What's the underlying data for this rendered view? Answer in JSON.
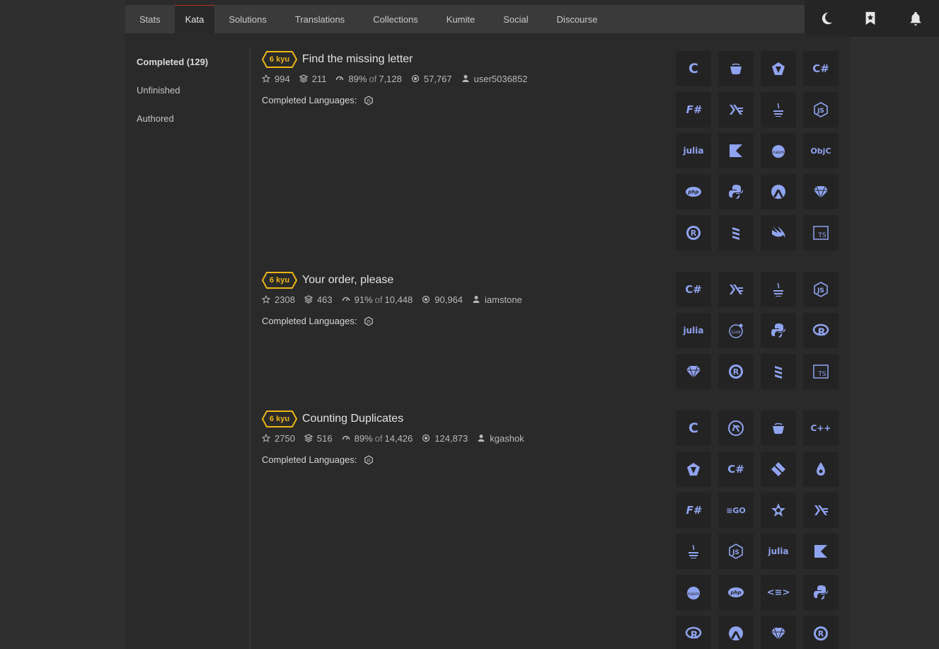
{
  "nav": {
    "tabs": [
      "Stats",
      "Kata",
      "Solutions",
      "Translations",
      "Collections",
      "Kumite",
      "Social",
      "Discourse"
    ],
    "active_tab": "Kata",
    "icons": [
      "moon-icon",
      "bookmark-star-icon",
      "bell-icon"
    ]
  },
  "sidebar": {
    "items": [
      {
        "label": "Completed (129)",
        "active": true
      },
      {
        "label": "Unfinished",
        "active": false
      },
      {
        "label": "Authored",
        "active": false
      }
    ]
  },
  "colors": {
    "accent": "#b1361e",
    "kyu": "#ecb613",
    "language_icon": "#8fa3ef"
  },
  "katas": [
    {
      "rank": "6 kyu",
      "title": "Find the missing letter",
      "stars": "994",
      "collections": "211",
      "satisfaction": "89%",
      "of_label": "of",
      "votes": "7,128",
      "completions": "57,767",
      "author": "user5036852",
      "completed_label": "Completed Languages:",
      "completed_language_icon": "node-hex-icon",
      "languages": [
        "c",
        "coffeescript",
        "crystal",
        "csharp",
        "fsharp",
        "haskell",
        "java",
        "javascript",
        "julia",
        "kotlin",
        "nasm",
        "objc",
        "php",
        "python",
        "racket",
        "ruby",
        "rust",
        "scala",
        "swift",
        "typescript"
      ]
    },
    {
      "rank": "6 kyu",
      "title": "Your order, please",
      "stars": "2308",
      "collections": "463",
      "satisfaction": "91%",
      "of_label": "of",
      "votes": "10,448",
      "completions": "90,964",
      "author": "iamstone",
      "completed_label": "Completed Languages:",
      "completed_language_icon": "node-hex-icon",
      "languages": [
        "csharp",
        "haskell",
        "java",
        "javascript",
        "julia",
        "lua",
        "python",
        "r",
        "ruby",
        "rust",
        "scala",
        "typescript"
      ]
    },
    {
      "rank": "6 kyu",
      "title": "Counting Duplicates",
      "stars": "2750",
      "collections": "516",
      "satisfaction": "89%",
      "of_label": "of",
      "votes": "14,426",
      "completions": "124,873",
      "author": "kgashok",
      "completed_label": "Completed Languages:",
      "completed_language_icon": "node-hex-icon",
      "languages": [
        "c",
        "clojure",
        "coffeescript",
        "cpp",
        "crystal",
        "csharp",
        "dart",
        "elixir",
        "fsharp",
        "go",
        "groovy",
        "haskell",
        "java",
        "javascript",
        "julia",
        "kotlin",
        "nasm",
        "php",
        "powershell",
        "python",
        "r",
        "racket",
        "ruby",
        "rust"
      ]
    }
  ]
}
